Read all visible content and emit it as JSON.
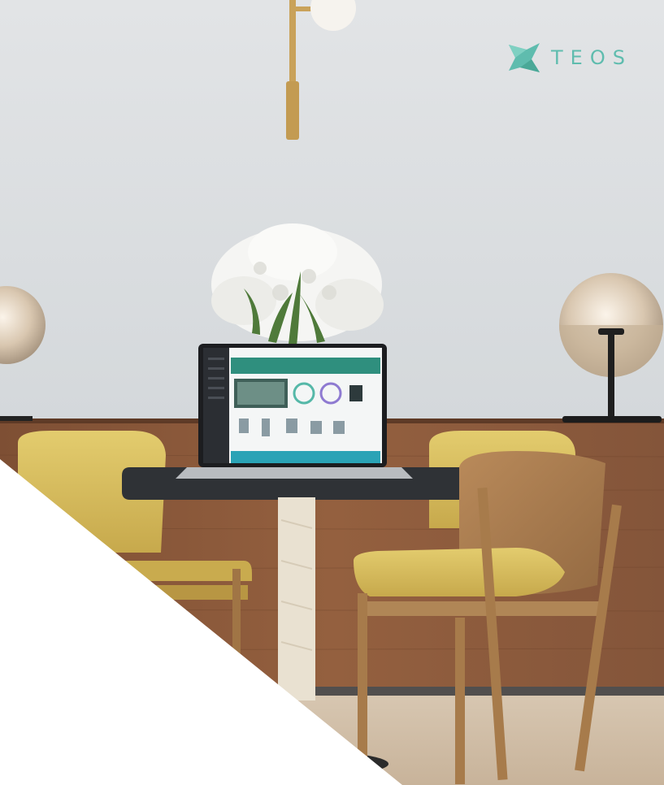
{
  "brand": {
    "name": "TEOS",
    "accent_color": "#5fbcae",
    "logo_icon": "teos-leaf-logo"
  },
  "laptop_screen": {
    "header_color": "#2f8f7e",
    "footer_color": "#2aa3b6"
  },
  "palette": {
    "wall": "#d9dde0",
    "sideboard": "#8c5a3c",
    "chair_seat": "#d9bf5a",
    "wood": "#b08050",
    "table_top": "#2f3236"
  }
}
